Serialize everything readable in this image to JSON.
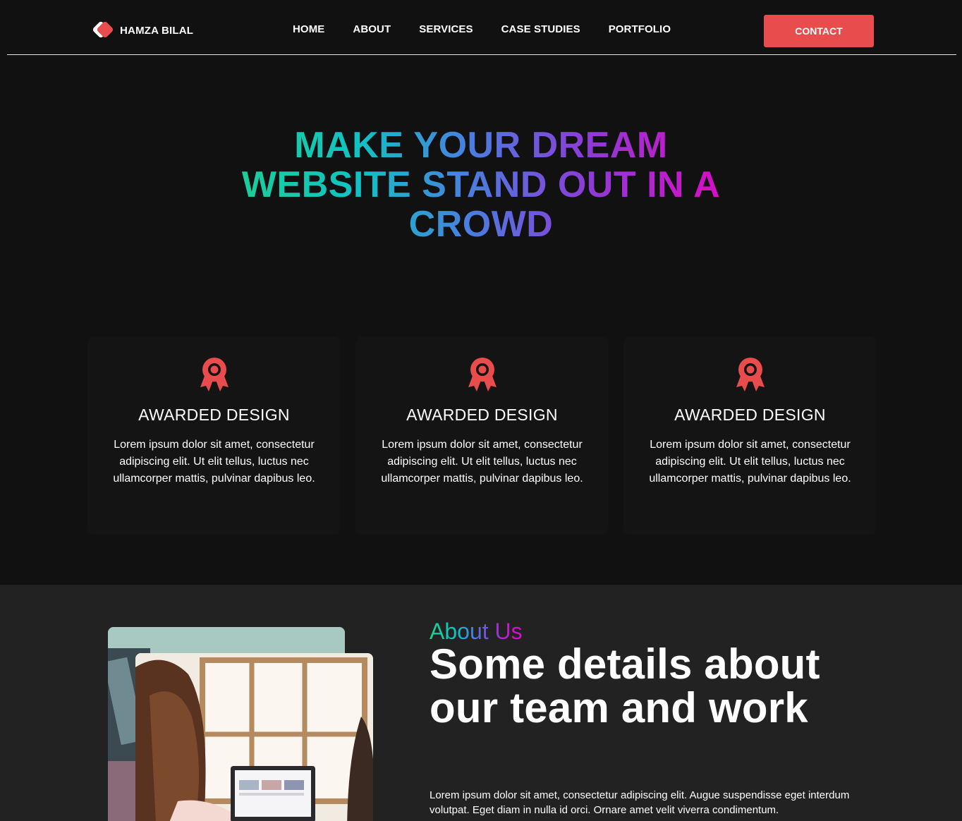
{
  "brand": {
    "name": "HAMZA BILAL",
    "accent": "#e84c4c"
  },
  "nav": {
    "items": [
      {
        "label": "HOME"
      },
      {
        "label": "ABOUT"
      },
      {
        "label": "SERVICES"
      },
      {
        "label": "CASE STUDIES"
      },
      {
        "label": "PORTFOLIO"
      }
    ],
    "contact_label": "CONTACT"
  },
  "hero": {
    "lines": [
      "MAKE YOUR DREAM",
      "WEBSITE STAND OUT IN A",
      "CROWD"
    ],
    "gradient": [
      "#1fd18a",
      "#10c3c3",
      "#4a7ee0",
      "#8a3ed6",
      "#d210c8"
    ]
  },
  "features": [
    {
      "icon": "award-ribbon-icon",
      "title": "AWARDED DESIGN",
      "text": "Lorem ipsum dolor sit amet, consectetur adipiscing elit. Ut elit tellus, luctus nec ullamcorper mattis, pulvinar dapibus leo."
    },
    {
      "icon": "award-ribbon-icon",
      "title": "AWARDED DESIGN",
      "text": "Lorem ipsum dolor sit amet, consectetur adipiscing elit. Ut elit tellus, luctus nec ullamcorper mattis, pulvinar dapibus leo."
    },
    {
      "icon": "award-ribbon-icon",
      "title": "AWARDED DESIGN",
      "text": "Lorem ipsum dolor sit amet, consectetur adipiscing elit. Ut elit tellus, luctus nec ullamcorper mattis, pulvinar dapibus leo."
    }
  ],
  "about": {
    "label": "About Us",
    "heading": "Some details about our team and work",
    "text": "Lorem ipsum dolor sit amet, consectetur adipiscing elit. Augue suspendisse eget interdum volutpat. Eget diam in nulla id orci. Ornare amet velit viverra condimentum."
  }
}
